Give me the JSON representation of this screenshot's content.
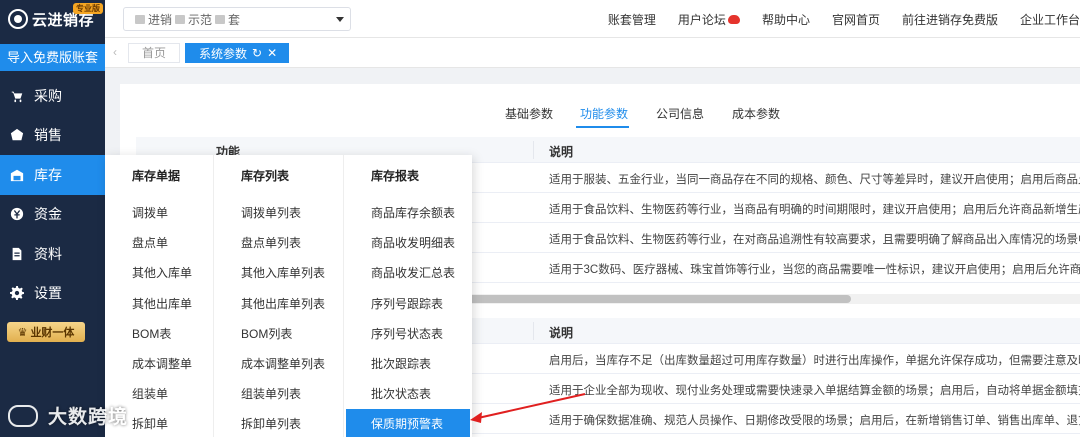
{
  "app": {
    "logo_text": "云进销存",
    "pro_badge": "专业版",
    "import_button": "导入免费版账套",
    "menu": [
      {
        "label": "采购",
        "icon": "cart-icon"
      },
      {
        "label": "销售",
        "icon": "sales-icon"
      },
      {
        "label": "库存",
        "icon": "warehouse-icon"
      },
      {
        "label": "资金",
        "icon": "money-icon"
      },
      {
        "label": "资料",
        "icon": "document-icon"
      },
      {
        "label": "设置",
        "icon": "gear-icon"
      }
    ],
    "active_menu": "库存",
    "yecai_label": "业财一体"
  },
  "header": {
    "account_name_parts": [
      "",
      "进销",
      "示范",
      "套"
    ],
    "links": [
      "账套管理",
      "用户论坛",
      "帮助中心",
      "官网首页",
      "前往进销存免费版",
      "企业工作台"
    ]
  },
  "tabs": {
    "home": "首页",
    "current": "系统参数",
    "refresh_glyph": "↻",
    "close_glyph": "✕",
    "prev_glyph": "‹"
  },
  "subtabs": [
    "基础参数",
    "功能参数",
    "公司信息",
    "成本参数"
  ],
  "active_subtab": "功能参数",
  "table1": {
    "col_function": "功能",
    "col_desc": "说明",
    "rows": [
      "适用于服装、五金行业，当同一商品存在不同的规格、颜色、尺寸等差异时，建议开启使用；启用后商品允许录",
      "适用于食品饮料、生物医药等行业，当商品有明确的时间期限时，建议开启使用；启用后允许商品新增生产日期、",
      "适用于食品饮料、生物医药等行业，在对商品追溯性有较高要求，且需要明确了解商品出入库情况的场景中，建议",
      "适用于3C数码、医疗器械、珠宝首饰等行业，当您的商品需要唯一性标识，建议开启使用；启用后允许商品新增"
    ]
  },
  "table2": {
    "col_desc": "说明",
    "rows": [
      "启用后，当库存不足（出库数量超过可用库存数量）时进行出库操作，单据允许保存成功，但需要注意及时补充库",
      "适用于企业全部为现收、现付业务处理或需要快速录入单据结算金额的场景；启用后，自动将单据金额填充本次收",
      "适用于确保数据准确、规范人员操作、日期修改受限的场景；启用后，在新增销售订单、销售出库单、退货单时，"
    ]
  },
  "dropdown": {
    "columns": [
      {
        "title": "库存单据",
        "items": [
          "调拨单",
          "盘点单",
          "其他入库单",
          "其他出库单",
          "BOM表",
          "成本调整单",
          "组装单",
          "拆卸单"
        ]
      },
      {
        "title": "库存列表",
        "items": [
          "调拨单列表",
          "盘点单列表",
          "其他入库单列表",
          "其他出库单列表",
          "BOM列表",
          "成本调整单列表",
          "组装单列表",
          "拆卸单列表"
        ]
      },
      {
        "title": "库存报表",
        "items": [
          "商品库存余额表",
          "商品收发明细表",
          "商品收发汇总表",
          "序列号跟踪表",
          "序列号状态表",
          "批次跟踪表",
          "批次状态表",
          "保质期预警表"
        ]
      }
    ],
    "highlighted_item": "保质期预警表"
  },
  "watermark": "大数跨境",
  "colors": {
    "sidebar_bg": "#1b2a44",
    "accent": "#1f8ceb",
    "annotation_arrow": "#e02020"
  }
}
